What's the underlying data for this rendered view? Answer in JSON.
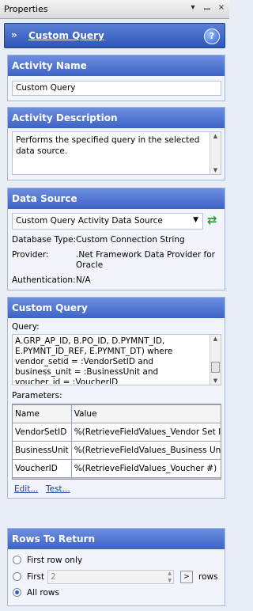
{
  "window": {
    "title": "Properties"
  },
  "header": {
    "title": "Custom Query"
  },
  "activity_name": {
    "heading": "Activity Name",
    "value": "Custom Query"
  },
  "activity_description": {
    "heading": "Activity Description",
    "text": "Performs the specified query in the selected data source."
  },
  "data_source": {
    "heading": "Data Source",
    "selected": "Custom Query Activity Data Source",
    "database_type_label": "Database Type:",
    "database_type_value": "Custom Connection String",
    "provider_label": "Provider:",
    "provider_value": ".Net Framework Data Provider for Oracle",
    "authentication_label": "Authentication:",
    "authentication_value": "N/A"
  },
  "custom_query": {
    "heading": "Custom Query",
    "query_label": "Query:",
    "query_text": "A.GRP_AP_ID, B.PO_ID, D.PYMNT_ID, E.PYMNT_ID_REF, E.PYMNT_DT) where vendor_setid = :VendorSetID and business_unit = :BusinessUnit and voucher_id = :VoucherID",
    "parameters_label": "Parameters:",
    "columns": [
      "Name",
      "Value"
    ],
    "rows": [
      {
        "name": "VendorSetID",
        "value": "%(RetrieveFieldValues_Vendor Set ID)"
      },
      {
        "name": "BusinessUnit",
        "value": "%(RetrieveFieldValues_Business Unit)"
      },
      {
        "name": "VoucherID",
        "value": "%(RetrieveFieldValues_Voucher #)"
      }
    ],
    "edit_link": "Edit...",
    "test_link": "Test..."
  },
  "rows_to_return": {
    "heading": "Rows To Return",
    "first_row_only": "First row only",
    "first": "First",
    "first_count": "2",
    "rows_suffix": "rows",
    "all_rows": "All rows",
    "selected": "All rows"
  },
  "colors": {
    "accent": "#3d63c6",
    "link": "#1b3f9a",
    "refresh": "#2e9a2e"
  }
}
